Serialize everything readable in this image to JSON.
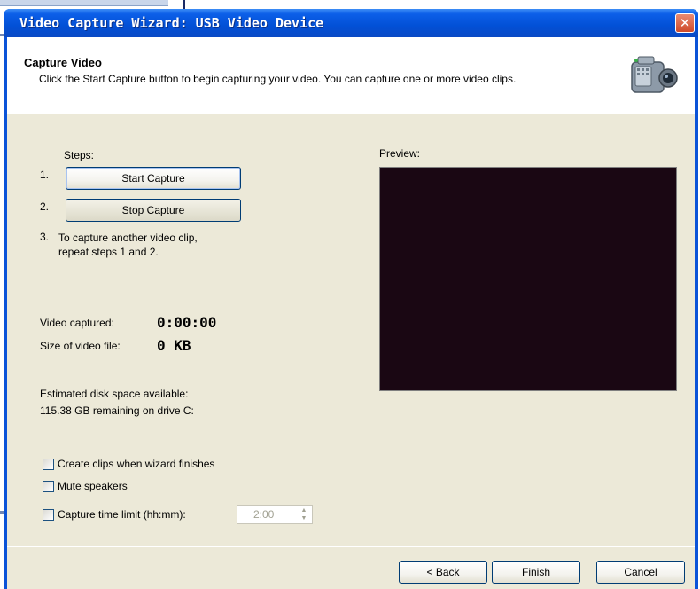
{
  "window": {
    "title": "Video Capture Wizard: USB Video Device",
    "close_glyph": "✕"
  },
  "header": {
    "title": "Capture Video",
    "description": "Click the Start Capture button to begin capturing your video. You can capture one or more video clips.",
    "icon": "video-camera-icon"
  },
  "steps": {
    "heading": "Steps:",
    "step1_num": "1.",
    "step1_button": "Start Capture",
    "step2_num": "2.",
    "step2_button": "Stop Capture",
    "step3_num": "3.",
    "step3_line1": "To capture another video clip,",
    "step3_line2": "repeat steps 1 and 2."
  },
  "stats": {
    "captured_label": "Video captured:",
    "captured_value": "0:00:00",
    "size_label": "Size of video file:",
    "size_value": "0 KB",
    "disk_label": "Estimated disk space available:",
    "disk_value": "115.38 GB remaining on drive C:"
  },
  "preview": {
    "label": "Preview:",
    "background": "#1a0713"
  },
  "options": {
    "create_clips": {
      "label": "Create clips when wizard finishes",
      "checked": false
    },
    "mute_speakers": {
      "label": "Mute speakers",
      "checked": false
    },
    "time_limit": {
      "label": "Capture time limit (hh:mm):",
      "checked": false,
      "value": "2:00"
    }
  },
  "footer": {
    "back": "< Back",
    "finish": "Finish",
    "cancel": "Cancel"
  },
  "colors": {
    "titlebar": "#0250d6",
    "dialog_bg": "#ece9d8",
    "close_button": "#cf4a2a"
  }
}
